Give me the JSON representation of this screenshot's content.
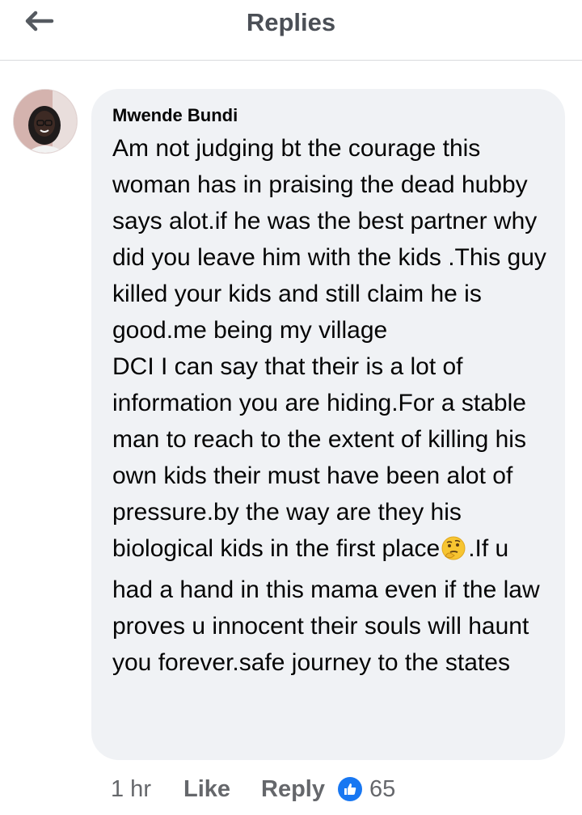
{
  "header": {
    "title": "Replies",
    "back_icon": "arrow-left-icon"
  },
  "comment": {
    "author": "Mwende Bundi",
    "avatar_icon": "profile-photo",
    "text_before_emoji": "Am not judging bt the courage this woman has in praising the dead hubby says alot.if he was the best partner why did you leave him with the kids .This guy killed your kids and still claim he is good.me being my village\nDCI I can say that their is a lot of information you are hiding.For a stable man to reach to the extent of killing his own kids their must have been alot of pressure.by the way are they his biological kids in the first place",
    "emoji_icon": "thinking-face-emoji",
    "text_after_emoji": ".If u had a hand in this mama even if the law  proves u innocent their souls will haunt you forever.safe journey to the states",
    "time": "1 hr",
    "like_label": "Like",
    "reply_label": "Reply",
    "reaction_icon": "thumbs-up-icon",
    "reaction_count": "65"
  },
  "colors": {
    "bubble": "#f0f2f5",
    "action_text": "#65676b",
    "reaction_badge": "#1877f2",
    "title_text": "#4b4f56"
  }
}
